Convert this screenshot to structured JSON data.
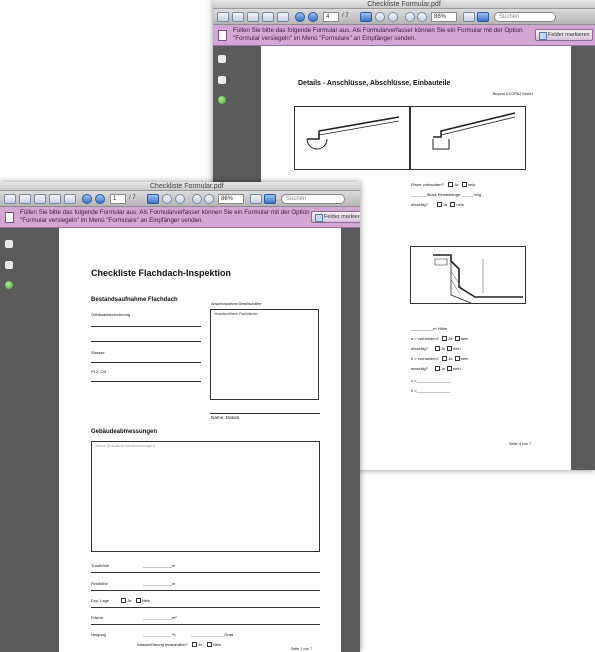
{
  "window_back": {
    "title": "Checkliste Formular.pdf",
    "page_field": "4",
    "page_total": "/ 7",
    "zoom": "86%",
    "search_placeholder": "Suchen",
    "form_message_line1": "Füllen Sie bitte das folgende Formular aus. Als Formularverfasser können Sie ein Formular mit der Option",
    "form_message_line2": "\"Formular versiegeln\" im Menü \"Formulare\" an Empfänger senden.",
    "highlight_button": "Felder markieren",
    "page": {
      "title": "Details - Anschlüsse, Abschlüsse, Einbauteile",
      "company": "Bioprot ECOPAJ GmbH",
      "q_left_1": "Rinne vorhanden?",
      "q_left_1_yes": "Ja",
      "q_left_1_no": "nein",
      "q_right_1": "Rinne vorhanden?",
      "q_right_1_yes": "Ja",
      "q_right_1_no": "nein",
      "q_right_2": "_______Stück   Rinnenlänge: _____m/lg",
      "q_right_3": "einseitig?",
      "q_right_3_yes": "Ja",
      "q_right_3_no": "nein",
      "height_label": "__________m Höhe",
      "q_a": "a > vorhanden?",
      "q_a_yes": "Ja",
      "q_a_no": "nein",
      "q_b": "einseitig?",
      "q_b_yes": "Ja",
      "q_b_no": "nein",
      "q_c": "b > vorhanden?",
      "q_c_yes": "Ja",
      "q_c_no": "nein",
      "q_d": "einseitig?",
      "q_d_yes": "Ja",
      "q_d_no": "nein",
      "line_c": "c >_______________",
      "line_d": "d >_______________",
      "page_footer": "Seite 4 von 7"
    }
  },
  "window_front": {
    "title": "Checkliste Formular.pdf",
    "page_field": "1",
    "page_total": "/ 7",
    "zoom": "86%",
    "search_placeholder": "Suchen",
    "form_message_line1": "Füllen Sie bitte das folgende Formular aus. Als Formularverfasser können Sie ein Formular mit der Option",
    "form_message_line2": "\"Formular versiegeln\" im Menü \"Formulare\" an Empfänger senden.",
    "highlight_button": "Felder markieren",
    "page": {
      "title": "Checkliste Flachdach-Inspektion",
      "section_1": "Bestandsaufnahme Flachdach",
      "field_building": "Gebäudebezeichnung",
      "contact_label": "Ansprechpartner/Gesellschafter",
      "contact_placeholder": "Verantwortlicher Flachdächer",
      "field_street": "Strasse",
      "field_city": "PLZ, Ort",
      "name_date": "Name, Datum",
      "section_2": "Gebäudeabmessungen",
      "dimensions_placeholder": "Skizze (Draufsicht mit Abmessungen)",
      "row_traufhoehe": "Traufhöhe",
      "row_traufhoehe_unit": "_____________m",
      "row_firsthoehe": "Firsthöhe",
      "row_firsthoehe_unit": "_____________m",
      "row_exp_lage": "Exp. Lage",
      "row_exp_yes": "Ja",
      "row_exp_no": "Nein",
      "row_flaeche": "Fläche",
      "row_flaeche_unit": "_____________m²",
      "row_neigung": "Neigung",
      "row_neigung_unit": "_____________%",
      "row_neigung_grad": "_______________Grad",
      "row_wasser": "Wasserführung einwandfrei?",
      "row_wasser_yes": "Ja",
      "row_wasser_no": "Nein",
      "page_footer": "Seite 1 von 7"
    }
  }
}
